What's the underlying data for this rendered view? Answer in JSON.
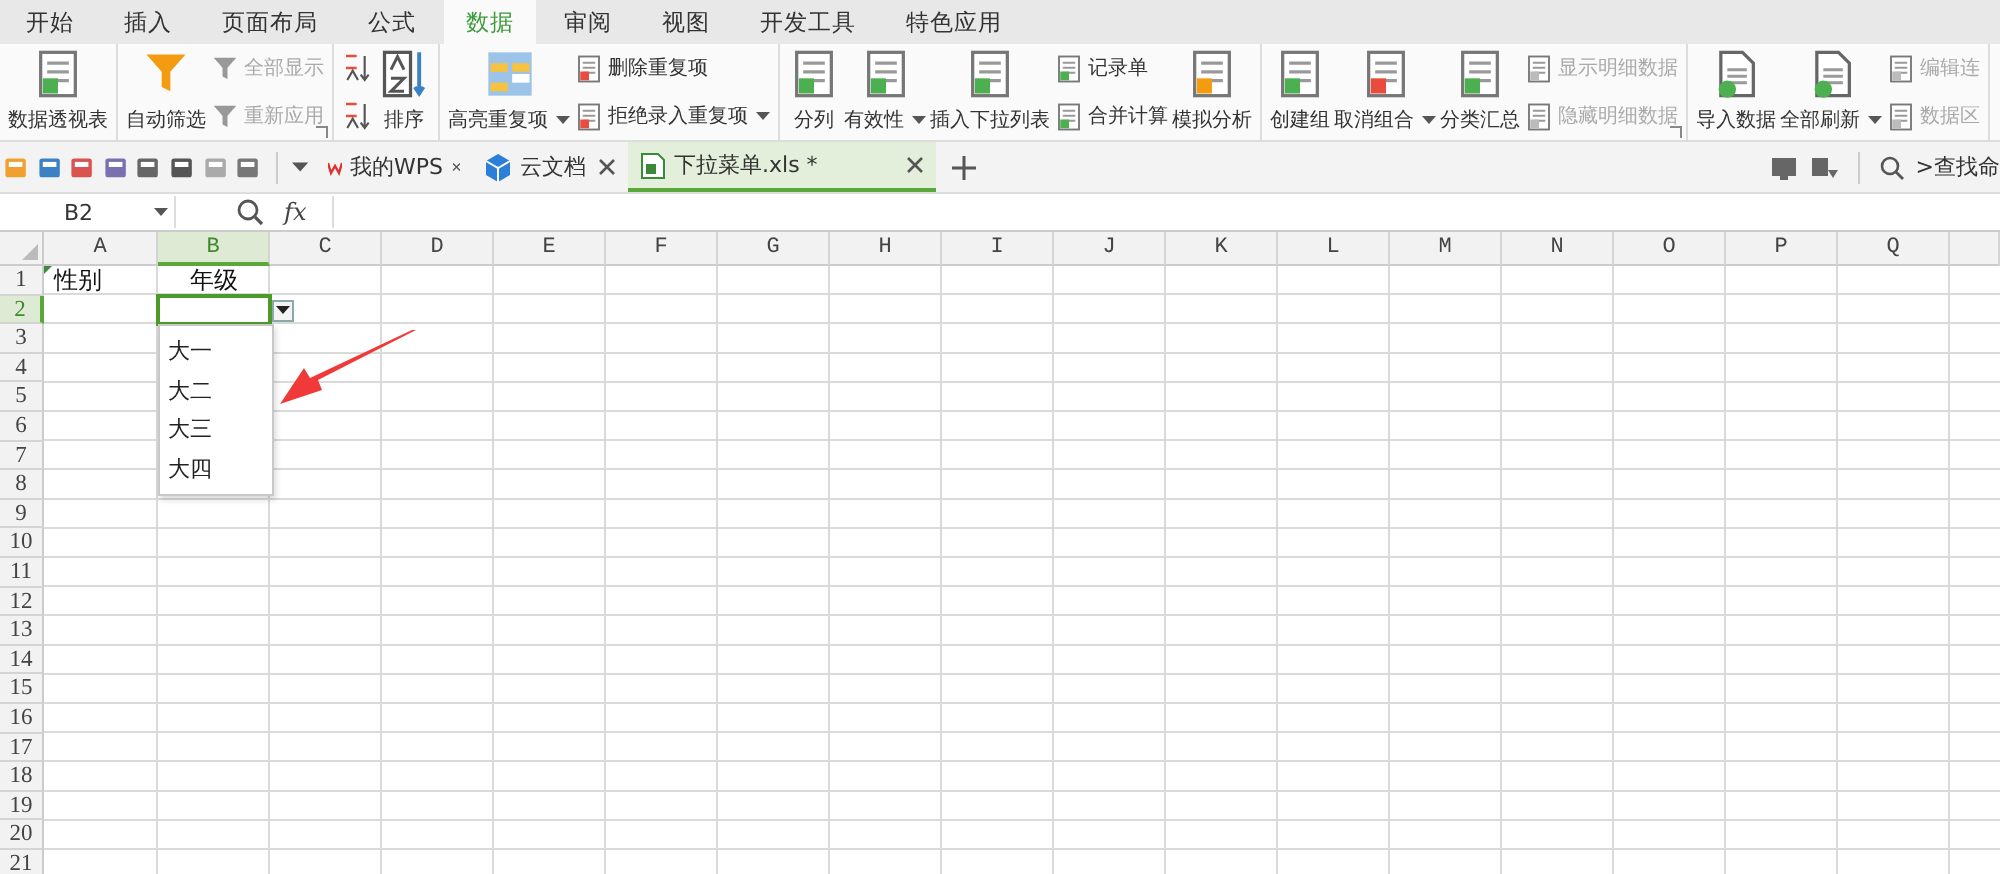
{
  "ribbon_tabs": [
    {
      "label": "开始",
      "selected": false
    },
    {
      "label": "插入",
      "selected": false
    },
    {
      "label": "页面布局",
      "selected": false
    },
    {
      "label": "公式",
      "selected": false
    },
    {
      "label": "数据",
      "selected": true
    },
    {
      "label": "审阅",
      "selected": false
    },
    {
      "label": "视图",
      "selected": false
    },
    {
      "label": "开发工具",
      "selected": false
    },
    {
      "label": "特色应用",
      "selected": false
    }
  ],
  "ribbon_groups": [
    {
      "dialog_launcher": false,
      "columns": [
        {
          "kind": "large",
          "label": "数据透视表",
          "dropdown": false,
          "disabled": false
        }
      ]
    },
    {
      "dialog_launcher": true,
      "columns": [
        {
          "kind": "large",
          "label": "自动筛选",
          "dropdown": false,
          "disabled": false
        },
        {
          "kind": "stack",
          "items": [
            {
              "kind": "labeled",
              "label": "全部显示",
              "dropdown": false,
              "disabled": true
            },
            {
              "kind": "labeled",
              "label": "重新应用",
              "dropdown": false,
              "disabled": true
            }
          ]
        }
      ]
    },
    {
      "dialog_launcher": false,
      "columns": [
        {
          "kind": "stack",
          "items": [
            {
              "kind": "icon"
            },
            {
              "kind": "icon"
            }
          ]
        },
        {
          "kind": "large",
          "label": "排序",
          "dropdown": false,
          "disabled": false
        }
      ]
    },
    {
      "dialog_launcher": false,
      "columns": [
        {
          "kind": "large",
          "label": "高亮重复项",
          "dropdown": true,
          "disabled": false
        },
        {
          "kind": "stack",
          "items": [
            {
              "kind": "labeled",
              "label": "删除重复项",
              "dropdown": false,
              "disabled": false
            },
            {
              "kind": "labeled",
              "label": "拒绝录入重复项",
              "dropdown": true,
              "disabled": false
            }
          ]
        }
      ]
    },
    {
      "dialog_launcher": false,
      "columns": [
        {
          "kind": "large",
          "label": "分列",
          "dropdown": false,
          "disabled": false
        },
        {
          "kind": "large",
          "label": "有效性",
          "dropdown": true,
          "disabled": false
        },
        {
          "kind": "large",
          "label": "插入下拉列表",
          "dropdown": false,
          "disabled": false
        },
        {
          "kind": "stack",
          "items": [
            {
              "kind": "labeled",
              "label": "记录单",
              "dropdown": false,
              "disabled": false
            },
            {
              "kind": "labeled",
              "label": "合并计算",
              "dropdown": false,
              "disabled": false
            }
          ]
        },
        {
          "kind": "large",
          "label": "模拟分析",
          "dropdown": false,
          "disabled": false
        }
      ]
    },
    {
      "dialog_launcher": true,
      "columns": [
        {
          "kind": "large",
          "label": "创建组",
          "dropdown": false,
          "disabled": false
        },
        {
          "kind": "large",
          "label": "取消组合",
          "dropdown": true,
          "disabled": false
        },
        {
          "kind": "large",
          "label": "分类汇总",
          "dropdown": false,
          "disabled": false
        },
        {
          "kind": "stack",
          "items": [
            {
              "kind": "labeled",
              "label": "显示明细数据",
              "dropdown": false,
              "disabled": true
            },
            {
              "kind": "labeled",
              "label": "隐藏明细数据",
              "dropdown": false,
              "disabled": true
            }
          ]
        }
      ]
    },
    {
      "dialog_launcher": false,
      "columns": [
        {
          "kind": "large",
          "label": "导入数据",
          "dropdown": false,
          "disabled": false
        },
        {
          "kind": "large",
          "label": "全部刷新",
          "dropdown": true,
          "disabled": false
        },
        {
          "kind": "stack",
          "items": [
            {
              "kind": "labeled",
              "label": "编辑连",
              "dropdown": false,
              "disabled": true
            },
            {
              "kind": "labeled",
              "label": "数据区",
              "dropdown": false,
              "disabled": true
            }
          ]
        }
      ]
    }
  ],
  "document_tabs": [
    {
      "label": "我的WPS",
      "kind": "wps",
      "selected": false
    },
    {
      "label": "云文档",
      "kind": "cloud",
      "selected": false
    },
    {
      "label": "下拉菜单.xls *",
      "kind": "sheet",
      "selected": true
    }
  ],
  "command_search": {
    "label": ">查找命"
  },
  "formula_bar": {
    "name_box": "B2",
    "fx": "fx"
  },
  "sheet": {
    "columns": [
      {
        "label": "A",
        "selected": false
      },
      {
        "label": "B",
        "selected": true
      },
      {
        "label": "C",
        "selected": false
      },
      {
        "label": "D",
        "selected": false
      },
      {
        "label": "E",
        "selected": false
      },
      {
        "label": "F",
        "selected": false
      },
      {
        "label": "G",
        "selected": false
      },
      {
        "label": "H",
        "selected": false
      },
      {
        "label": "I",
        "selected": false
      },
      {
        "label": "J",
        "selected": false
      },
      {
        "label": "K",
        "selected": false
      },
      {
        "label": "L",
        "selected": false
      },
      {
        "label": "M",
        "selected": false
      },
      {
        "label": "N",
        "selected": false
      },
      {
        "label": "O",
        "selected": false
      },
      {
        "label": "P",
        "selected": false
      },
      {
        "label": "Q",
        "selected": false
      }
    ],
    "rows": [
      {
        "label": "1",
        "selected": false,
        "cells": [
          {
            "text": "性别",
            "centered": false
          },
          {
            "text": "年级",
            "centered": true
          }
        ]
      },
      {
        "label": "2",
        "selected": true
      },
      {
        "label": "3",
        "selected": false
      },
      {
        "label": "4",
        "selected": false
      },
      {
        "label": "5",
        "selected": false
      },
      {
        "label": "6",
        "selected": false
      },
      {
        "label": "7",
        "selected": false
      },
      {
        "label": "8",
        "selected": false
      },
      {
        "label": "9",
        "selected": false
      },
      {
        "label": "10",
        "selected": false
      },
      {
        "label": "11",
        "selected": false
      },
      {
        "label": "12",
        "selected": false
      },
      {
        "label": "13",
        "selected": false
      },
      {
        "label": "14",
        "selected": false
      },
      {
        "label": "15",
        "selected": false
      },
      {
        "label": "16",
        "selected": false
      },
      {
        "label": "17",
        "selected": false
      },
      {
        "label": "18",
        "selected": false
      },
      {
        "label": "19",
        "selected": false
      },
      {
        "label": "20",
        "selected": false
      },
      {
        "label": "21",
        "selected": false
      }
    ],
    "dropdown": {
      "options": [
        "大一",
        "大二",
        "大三",
        "大四"
      ]
    }
  }
}
